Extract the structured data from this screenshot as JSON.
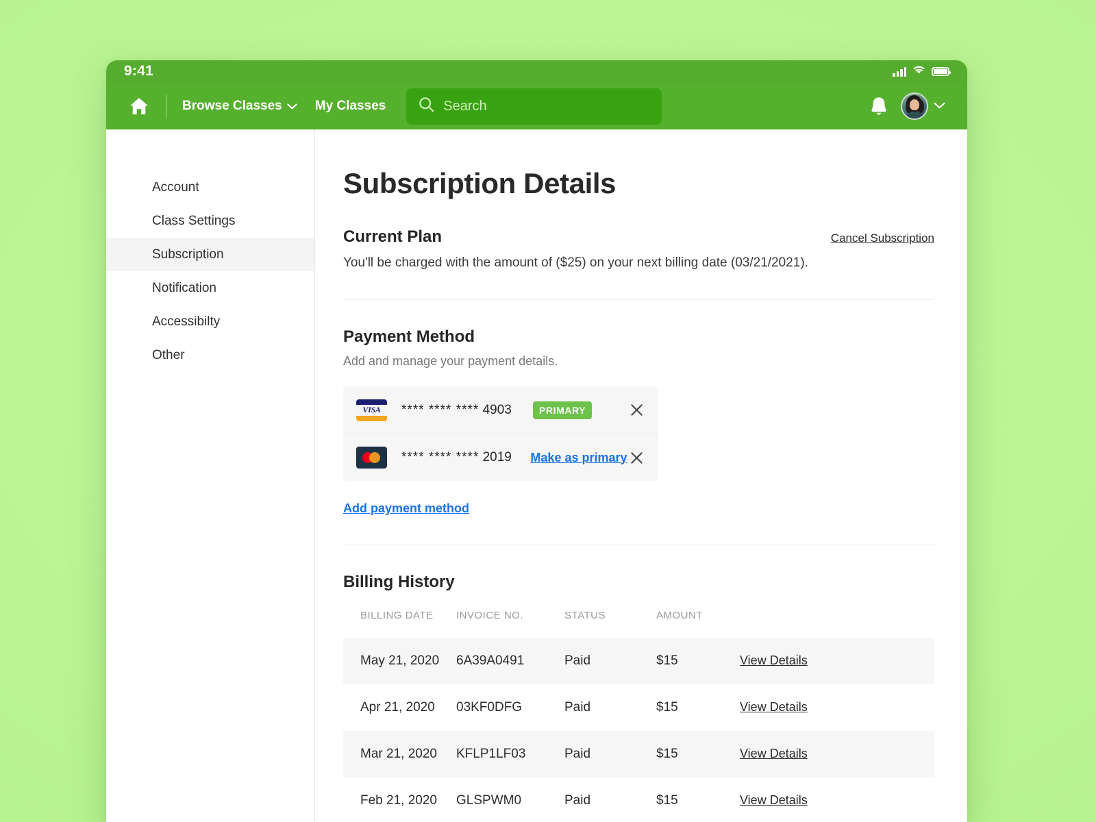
{
  "status_bar": {
    "time": "9:41",
    "icons": [
      "signal-icon",
      "wifi-icon",
      "battery-icon"
    ]
  },
  "navbar": {
    "home_icon": "home-icon",
    "browse_classes": "Browse Classes",
    "browse_chevron": "chevron-down-icon",
    "my_classes": "My Classes",
    "search": {
      "icon": "search-icon",
      "placeholder": "Search",
      "value": ""
    },
    "notification_icon": "bell-icon",
    "avatar": "user-avatar",
    "profile_chevron": "chevron-down-icon",
    "colors": {
      "status_bar": "#56ac2f",
      "navbar": "#55b02d",
      "search_field": "#39a211"
    }
  },
  "sidebar": {
    "items": [
      {
        "label": "Account",
        "active": false
      },
      {
        "label": "Class Settings",
        "active": false
      },
      {
        "label": "Subscription",
        "active": true
      },
      {
        "label": "Notification",
        "active": false
      },
      {
        "label": "Accessibilty",
        "active": false
      },
      {
        "label": "Other",
        "active": false
      }
    ]
  },
  "main": {
    "page_title": "Subscription Details",
    "current_plan": {
      "title": "Current Plan",
      "cancel_link": "Cancel Subscription",
      "description": "You'll be charged with the amount of ($25) on your next billing date (03/21/2021)."
    },
    "payment_method": {
      "title": "Payment Method",
      "subtitle": "Add and manage your payment details.",
      "cards": [
        {
          "brand": "visa",
          "brand_label": "VISA",
          "number": "**** **** ****",
          "last4": "4903",
          "badge": "PRIMARY",
          "action": null,
          "remove_icon": "close-icon"
        },
        {
          "brand": "mastercard",
          "brand_label": "",
          "number": "**** **** ****",
          "last4": "2019",
          "badge": null,
          "action": "Make as primary",
          "remove_icon": "close-icon"
        }
      ],
      "add_link": "Add payment method",
      "colors": {
        "primary_badge": "#6cc24a",
        "link": "#1a73e8"
      }
    },
    "billing_history": {
      "title": "Billing History",
      "columns": [
        "BILLING DATE",
        "INVOICE NO.",
        "STATUS",
        "AMOUNT",
        ""
      ],
      "rows": [
        {
          "date": "May 21, 2020",
          "invoice": "6A39A0491",
          "status": "Paid",
          "amount": "$15",
          "action": "View Details"
        },
        {
          "date": "Apr 21, 2020",
          "invoice": "03KF0DFG",
          "status": "Paid",
          "amount": "$15",
          "action": "View Details"
        },
        {
          "date": "Mar 21, 2020",
          "invoice": "KFLP1LF03",
          "status": "Paid",
          "amount": "$15",
          "action": "View Details"
        },
        {
          "date": "Feb 21, 2020",
          "invoice": "GLSPWM0",
          "status": "Paid",
          "amount": "$15",
          "action": "View Details"
        }
      ]
    }
  }
}
